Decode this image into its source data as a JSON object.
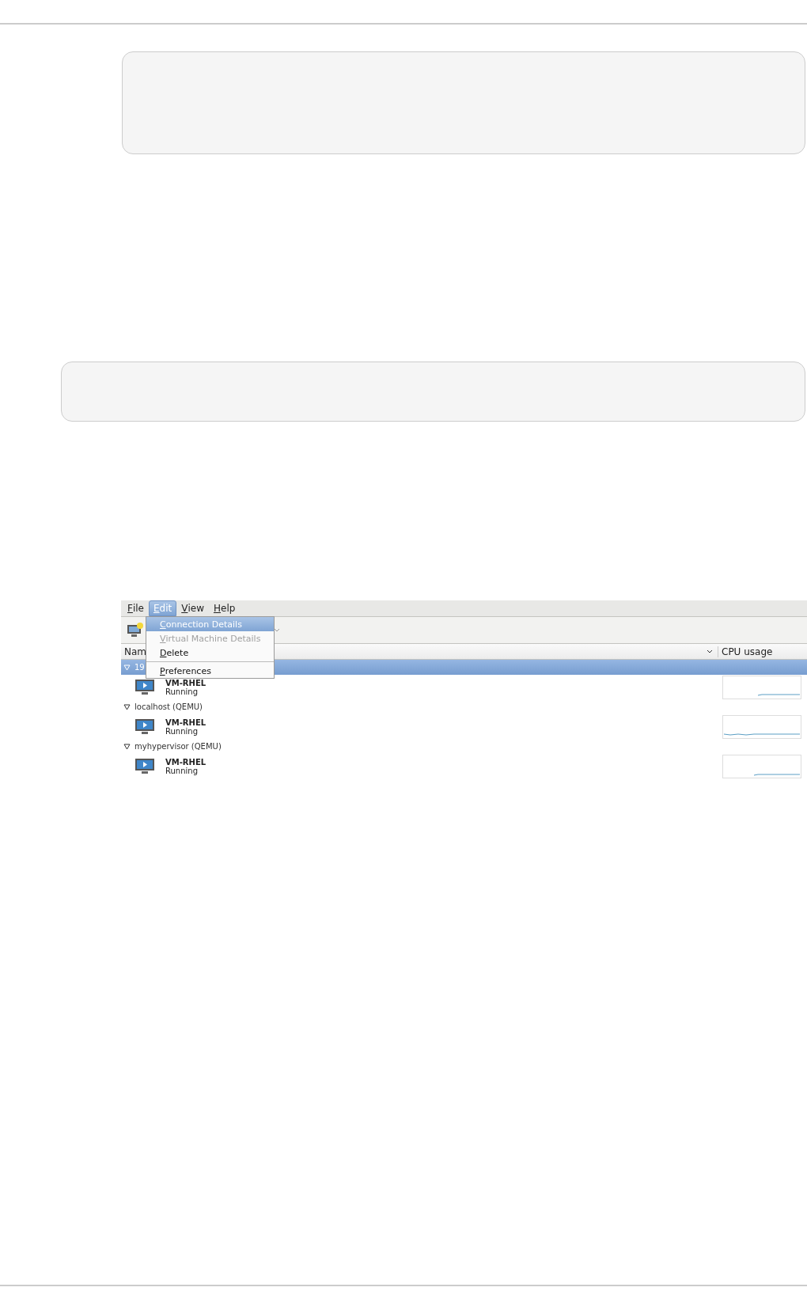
{
  "menubar": [
    {
      "label": "File",
      "selected": false
    },
    {
      "label": "Edit",
      "selected": true
    },
    {
      "label": "View",
      "selected": false
    },
    {
      "label": "Help",
      "selected": false
    }
  ],
  "menu": {
    "items": [
      {
        "kind": "item",
        "label": "Connection Details",
        "selected": true,
        "disabled": false
      },
      {
        "kind": "item",
        "label": "Virtual Machine Details",
        "selected": false,
        "disabled": true
      },
      {
        "kind": "item",
        "label": "Delete",
        "selected": false,
        "disabled": false
      },
      {
        "kind": "separator"
      },
      {
        "kind": "item",
        "label": "Preferences",
        "selected": false,
        "disabled": false
      }
    ]
  },
  "columns": [
    {
      "label": "Nam"
    },
    {
      "label": "CPU usage"
    }
  ],
  "groups": [
    {
      "label": "19",
      "selected": true,
      "expanded": true,
      "children": [
        {
          "name": "VM-RHEL",
          "status": "Running"
        }
      ]
    },
    {
      "label": "localhost (QEMU)",
      "selected": false,
      "expanded": true,
      "children": [
        {
          "name": "VM-RHEL",
          "status": "Running"
        }
      ]
    },
    {
      "label": "myhypervisor (QEMU)",
      "selected": false,
      "expanded": true,
      "children": [
        {
          "name": "VM-RHEL",
          "status": "Running"
        }
      ]
    }
  ]
}
